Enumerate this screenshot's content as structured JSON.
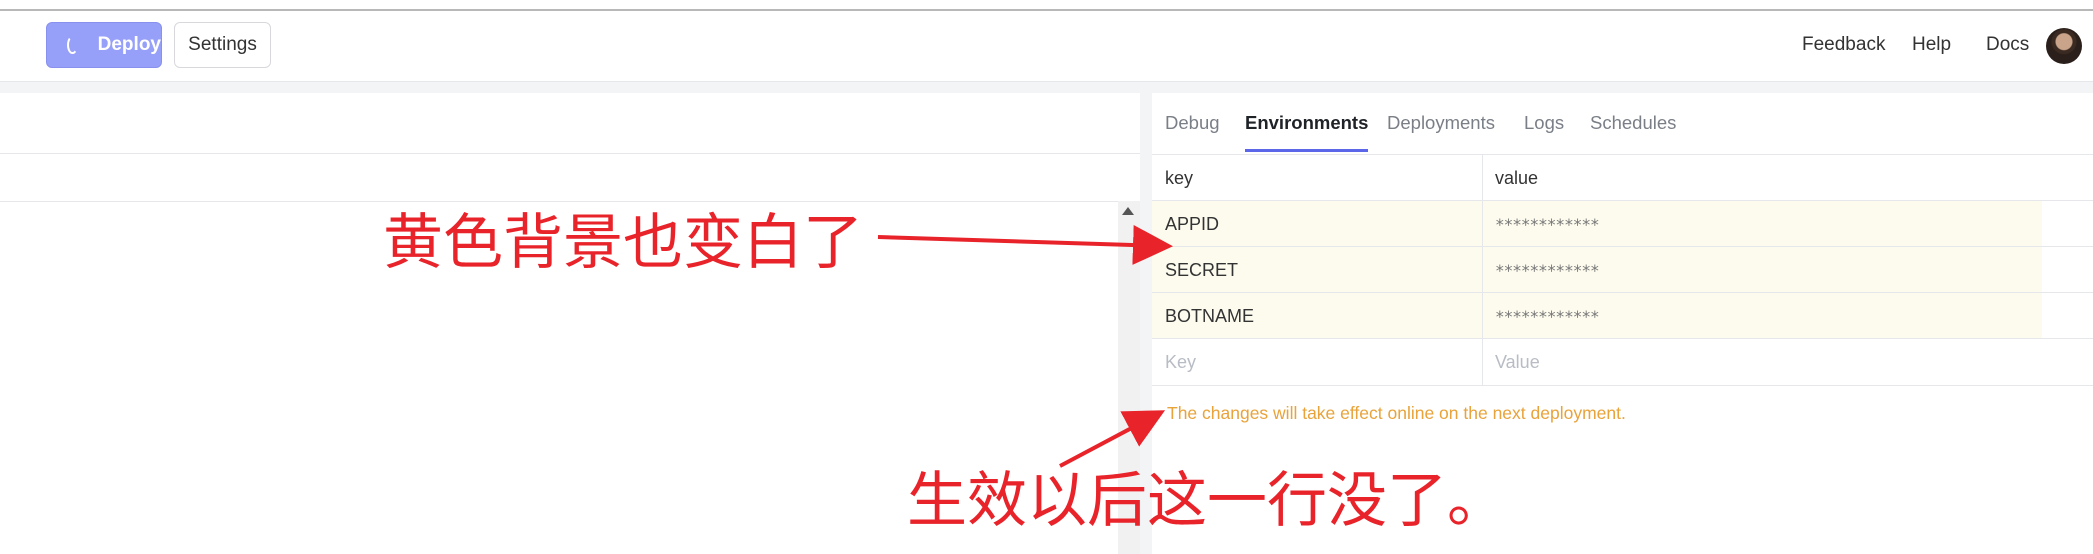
{
  "header": {
    "deploy_label": "Deploy",
    "settings_label": "Settings",
    "nav": [
      "Feedback",
      "Help",
      "Docs"
    ]
  },
  "tabs": [
    {
      "label": "Debug",
      "active": false
    },
    {
      "label": "Environments",
      "active": true
    },
    {
      "label": "Deployments",
      "active": false
    },
    {
      "label": "Logs",
      "active": false
    },
    {
      "label": "Schedules",
      "active": false
    }
  ],
  "env_table": {
    "headers": {
      "key": "key",
      "value": "value"
    },
    "rows": [
      {
        "key": "APPID",
        "value": "************"
      },
      {
        "key": "SECRET",
        "value": "************"
      },
      {
        "key": "BOTNAME",
        "value": "************"
      }
    ],
    "new_row": {
      "key_placeholder": "Key",
      "value_placeholder": "Value"
    }
  },
  "notice": "The changes will take effect online on the next deployment.",
  "annotations": {
    "top": "黄色背景也变白了",
    "bottom": "生效以后这一行没了。"
  },
  "colors": {
    "accent": "#5b67e8",
    "deploy_bg": "#97a0f8",
    "notice": "#e8a33a",
    "row_highlight": "#fdfbee",
    "annotation": "#e8232a"
  }
}
